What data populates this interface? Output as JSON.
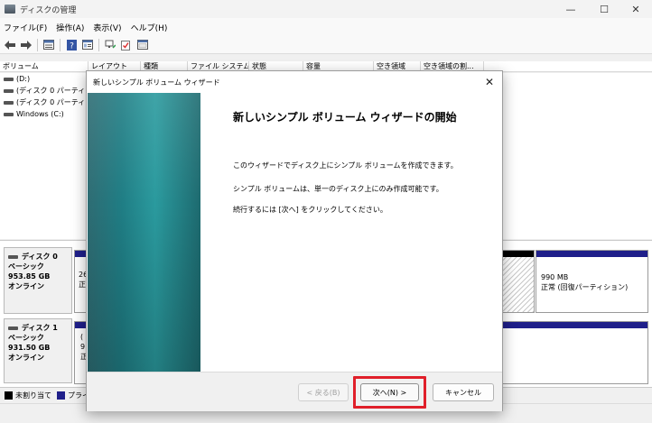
{
  "window": {
    "title": "ディスクの管理",
    "minimize": "—",
    "maximize": "☐",
    "close": "✕"
  },
  "menu": [
    "ファイル(F)",
    "操作(A)",
    "表示(V)",
    "ヘルプ(H)"
  ],
  "toolbar_icons": [
    "back-icon",
    "forward-icon",
    "list-view-icon",
    "help-icon",
    "properties-icon",
    "connect-icon",
    "check-icon",
    "console-icon"
  ],
  "volume_table": {
    "columns": [
      "ボリューム",
      "レイアウト",
      "種類",
      "ファイル システム",
      "状態",
      "容量",
      "空き領域",
      "空き領域の割..."
    ],
    "rows": [
      "(D:)",
      "(ディスク 0 パーティシ...",
      "(ディスク 0 パーティシ...",
      "Windows (C:)"
    ]
  },
  "disks": [
    {
      "name": "ディスク 0",
      "type": "ベーシック",
      "size": "953.85 GB",
      "status": "オンライン",
      "partial_partition": [
        "26",
        "正"
      ],
      "recovery_partition": {
        "size": "990 MB",
        "status": "正常 (回復パーティション)"
      }
    },
    {
      "name": "ディスク 1",
      "type": "ベーシック",
      "size": "931.50 GB",
      "status": "オンライン",
      "partial_partition": [
        "(",
        "9",
        "正"
      ]
    }
  ],
  "legend": [
    {
      "label": "未割り当て",
      "color": "#000000"
    },
    {
      "label": "プライ",
      "color": "#1f1f8a"
    }
  ],
  "wizard": {
    "title": "新しいシンプル ボリューム ウィザード",
    "heading": "新しいシンプル ボリューム ウィザードの開始",
    "para1": "このウィザードでディスク上にシンプル ボリュームを作成できます。",
    "para2": "シンプル ボリュームは、単一のディスク上にのみ作成可能です。",
    "para3": "続行するには [次へ] をクリックしてください。",
    "back_label": "< 戻る(B)",
    "next_label": "次へ(N) >",
    "cancel_label": "キャンセル",
    "close": "✕"
  },
  "colors": {
    "highlight": "#e01f2a",
    "primary_partition": "#1f1f8a",
    "unallocated": "#000000",
    "banner": "#1f7d84"
  }
}
